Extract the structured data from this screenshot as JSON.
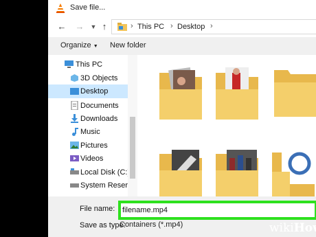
{
  "window": {
    "title": "Save file..."
  },
  "address": {
    "segments": [
      "This PC",
      "Desktop"
    ]
  },
  "toolbar": {
    "organize_label": "Organize",
    "new_folder_label": "New folder"
  },
  "sidebar": {
    "items": [
      {
        "label": "This PC",
        "icon": "computer-icon"
      },
      {
        "label": "3D Objects",
        "icon": "3d-objects-icon"
      },
      {
        "label": "Desktop",
        "icon": "desktop-folder-icon",
        "selected": true
      },
      {
        "label": "Documents",
        "icon": "documents-icon"
      },
      {
        "label": "Downloads",
        "icon": "downloads-icon"
      },
      {
        "label": "Music",
        "icon": "music-icon"
      },
      {
        "label": "Pictures",
        "icon": "pictures-icon"
      },
      {
        "label": "Videos",
        "icon": "videos-icon"
      },
      {
        "label": "Local Disk (C:)",
        "icon": "drive-icon"
      },
      {
        "label": "System Reserved",
        "icon": "drive-icon"
      }
    ]
  },
  "files": {
    "label": "File name:",
    "value": "filename.mp4",
    "type_label": "Save as type:",
    "type_value": "Containers (*.mp4)"
  },
  "watermark": {
    "part1": "wiki",
    "part2": "How"
  },
  "colors": {
    "highlight": "#2ee11e",
    "selected": "#cce8ff",
    "folder": "#f2c45a"
  }
}
